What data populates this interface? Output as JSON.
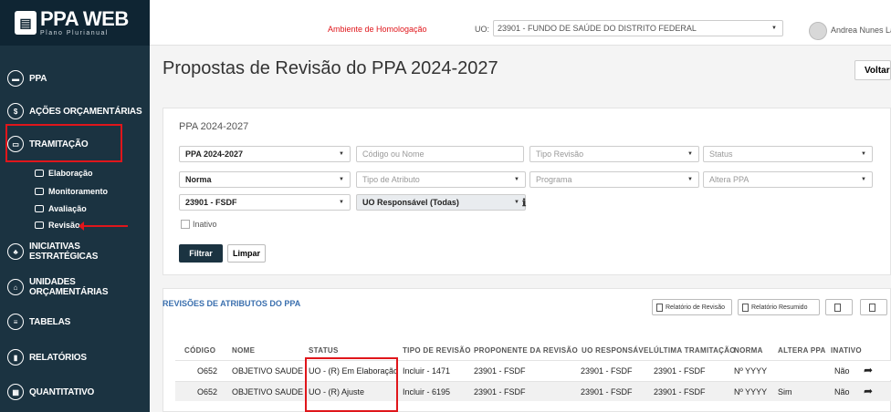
{
  "app": {
    "logo_title": "PPA WEB",
    "logo_sub": "Plano Plurianual",
    "environment": "Ambiente de Homologação",
    "uo_label": "UO:",
    "uo_value": "23901 - FUNDO DE SAÚDE DO DISTRITO FEDERAL",
    "user": "Andrea Nunes La..."
  },
  "sidebar": {
    "items": [
      {
        "label": "PPA",
        "icon": "book-icon"
      },
      {
        "label": "AÇÕES ORÇAMENTÁRIAS",
        "icon": "dollar-icon"
      },
      {
        "label": "TRAMITAÇÃO",
        "icon": "inbox-icon"
      },
      {
        "label": "INICIATIVAS ESTRATÉGICAS",
        "icon": "sitemap-icon"
      },
      {
        "label": "UNIDADES ORÇAMENTÁRIAS",
        "icon": "bank-icon"
      },
      {
        "label": "TABELAS",
        "icon": "list-icon"
      },
      {
        "label": "RELATÓRIOS",
        "icon": "report-icon"
      },
      {
        "label": "QUANTITATIVO",
        "icon": "chart-icon"
      }
    ],
    "subitems": [
      "Elaboração",
      "Monitoramento",
      "Avaliação",
      "Revisão"
    ]
  },
  "page": {
    "title": "Propostas de Revisão do PPA 2024-2027",
    "back_button": "Voltar"
  },
  "filters": {
    "panel_title": "PPA 2024-2027",
    "ppa": "PPA 2024-2027",
    "codigo_placeholder": "Código ou Nome",
    "tipo_revisao": "Tipo Revisão",
    "status": "Status",
    "norma": "Norma",
    "tipo_atributo": "Tipo de Atributo",
    "programa": "Programa",
    "altera_ppa": "Altera PPA",
    "uo": "23901 - FSDF",
    "uo_responsavel": "UO Responsável (Todas)",
    "inativo": "Inativo",
    "filtrar": "Filtrar",
    "limpar": "Limpar"
  },
  "table": {
    "section_title": "REVISÕES DE ATRIBUTOS DO PPA",
    "btn_relatorio_revisao": "Relatório de Revisão",
    "btn_relatorio_resumido": "Relatório Resumido",
    "headers": [
      "CÓDIGO",
      "NOME",
      "STATUS",
      "TIPO DE REVISÃO",
      "PROPONENTE DA REVISÃO",
      "UO RESPONSÁVEL",
      "ÚLTIMA TRAMITAÇÃO",
      "NORMA",
      "ALTERA PPA",
      "INATIVO"
    ],
    "rows": [
      [
        "O652",
        "OBJETIVO SAUDE",
        "UO - (R) Em Elaboração",
        "Incluir - 1471",
        "23901 - FSDF",
        "23901 - FSDF",
        "23901 - FSDF",
        "Nº YYYY",
        "",
        "Não"
      ],
      [
        "O652",
        "OBJETIVO SAUDE",
        "UO - (R) Ajuste",
        "Incluir - 6195",
        "23901 - FSDF",
        "23901 - FSDF",
        "23901 - FSDF",
        "Nº YYYY",
        "Sim",
        "Não"
      ]
    ]
  },
  "colors": {
    "sidebar_bg": "#1b3341",
    "highlight_red": "#e0161b",
    "link_blue": "#3a6fae"
  }
}
